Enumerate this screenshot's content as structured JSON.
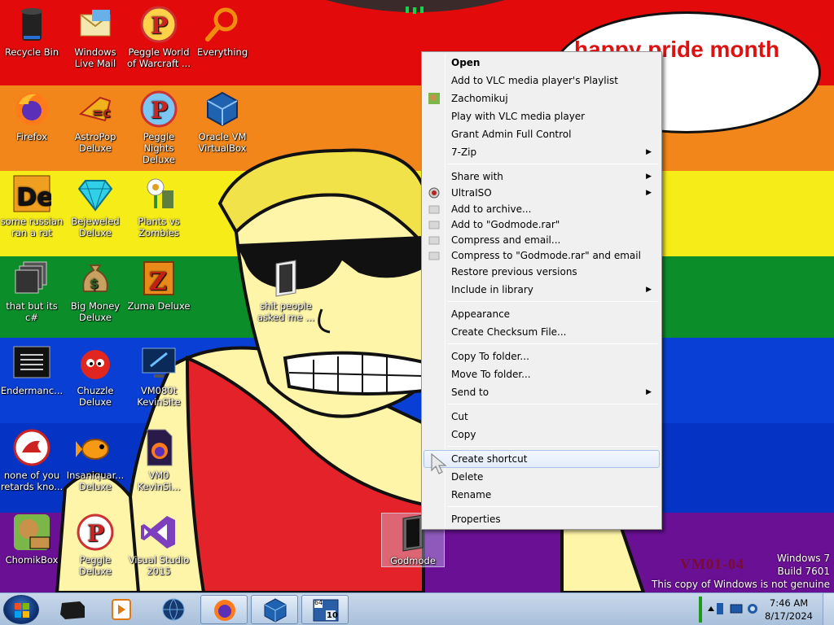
{
  "desktop": {
    "speech_bubble": "happy pride month\ne!",
    "watermark": "VM01-04",
    "windows_info": {
      "edition": "Windows 7",
      "build": "Build 7601",
      "genuine": "This copy of Windows is not genuine"
    },
    "icons": [
      {
        "id": "recycle-bin",
        "label": "Recycle Bin",
        "icon": "recycle-bin-icon"
      },
      {
        "id": "windows-live-mail",
        "label": "Windows Live Mail",
        "icon": "mail-icon"
      },
      {
        "id": "peggle-world-of-warcraft",
        "label": "Peggle World of Warcraft ...",
        "icon": "peggle-icon"
      },
      {
        "id": "everything",
        "label": "Everything",
        "icon": "magnifier-icon"
      },
      {
        "id": "firefox",
        "label": "Firefox",
        "icon": "firefox-icon"
      },
      {
        "id": "astropop-deluxe",
        "label": "AstroPop Deluxe",
        "icon": "astropop-icon"
      },
      {
        "id": "peggle-nights-deluxe",
        "label": "Peggle Nights Deluxe",
        "icon": "peggle-icon"
      },
      {
        "id": "oracle-vm-virtualbox",
        "label": "Oracle VM VirtualBox",
        "icon": "virtualbox-icon"
      },
      {
        "id": "some-russian-ran-a-rat",
        "label": "some russian ran a rat",
        "icon": "de-icon"
      },
      {
        "id": "bejeweled-deluxe",
        "label": "Bejeweled Deluxe",
        "icon": "gem-icon"
      },
      {
        "id": "plants-vs-zombies",
        "label": "Plants vs Zombies",
        "icon": "flower-icon"
      },
      {
        "id": "that-but-its-c",
        "label": "that but its c#",
        "icon": "stack-icon"
      },
      {
        "id": "big-money-deluxe",
        "label": "Big Money Deluxe",
        "icon": "money-bag-icon"
      },
      {
        "id": "zuma-deluxe",
        "label": "Zuma Deluxe",
        "icon": "zuma-icon"
      },
      {
        "id": "shit-people-asked-me",
        "label": "shit people asked me ...",
        "icon": "folder-icon"
      },
      {
        "id": "endermanch",
        "label": "Endermanc...",
        "icon": "terminal-icon"
      },
      {
        "id": "chuzzle-deluxe",
        "label": "Chuzzle Deluxe",
        "icon": "chuzzle-icon"
      },
      {
        "id": "vm080t-kevinsite",
        "label": "VM080t KevinSite",
        "icon": "vm-monitor-icon"
      },
      {
        "id": "none-of-you-retards-know",
        "label": "none of you retards kno...",
        "icon": "dragon-icon"
      },
      {
        "id": "insaniquarium-deluxe",
        "label": "Insaniquar... Deluxe",
        "icon": "fish-icon"
      },
      {
        "id": "vm0-kevinsite",
        "label": "VM0 KevinSi...",
        "icon": "firefox-file-icon"
      },
      {
        "id": "chomikbox",
        "label": "ChomikBox",
        "icon": "chomik-icon"
      },
      {
        "id": "peggle-deluxe",
        "label": "Peggle Deluxe",
        "icon": "peggle-icon"
      },
      {
        "id": "visual-studio-2015",
        "label": "Visual Studio 2015",
        "icon": "visual-studio-icon"
      },
      {
        "id": "godmode",
        "label": "Godmode",
        "icon": "folder-dark-icon"
      }
    ]
  },
  "context_menu": {
    "items": [
      {
        "label": "Open",
        "bold": true
      },
      {
        "label": "Add to VLC media player's Playlist"
      },
      {
        "label": "Zachomikuj",
        "icon": "chomik-icon"
      },
      {
        "label": "Play with VLC media player"
      },
      {
        "label": "Grant Admin Full Control"
      },
      {
        "label": "7-Zip",
        "submenu": true
      },
      {
        "label": "Share with",
        "submenu": true
      },
      {
        "label": "UltraISO",
        "submenu": true,
        "icon": "ultraiso-icon"
      },
      {
        "label": "Add to archive...",
        "icon": "winrar-icon"
      },
      {
        "label": "Add to \"Godmode.rar\"",
        "icon": "winrar-icon"
      },
      {
        "label": "Compress and email...",
        "icon": "winrar-icon"
      },
      {
        "label": "Compress to \"Godmode.rar\" and email",
        "icon": "winrar-icon"
      },
      {
        "label": "Restore previous versions"
      },
      {
        "label": "Include in library",
        "submenu": true
      },
      {
        "label": "Appearance"
      },
      {
        "label": "Create Checksum File..."
      },
      {
        "label": "Copy To folder..."
      },
      {
        "label": "Move To folder..."
      },
      {
        "label": "Send to",
        "submenu": true
      },
      {
        "label": "Cut"
      },
      {
        "label": "Copy"
      },
      {
        "label": "Create shortcut",
        "highlighted": true
      },
      {
        "label": "Delete"
      },
      {
        "label": "Rename"
      },
      {
        "label": "Properties"
      }
    ],
    "submenu_arrow": "▶"
  },
  "taskbar": {
    "buttons": [
      {
        "id": "tb-terminal",
        "icon": "black-box-icon"
      },
      {
        "id": "tb-media",
        "icon": "media-player-icon"
      },
      {
        "id": "tb-globe",
        "icon": "globe-icon"
      },
      {
        "id": "tb-firefox",
        "icon": "firefox-icon"
      },
      {
        "id": "tb-virtualbox",
        "icon": "virtualbox-icon"
      },
      {
        "id": "tb-vm",
        "icon": "vm-window-icon",
        "badge_top": "64",
        "badge_bottom": "10"
      }
    ],
    "clock": {
      "time": "7:46 AM",
      "date": "8/17/2024"
    }
  }
}
